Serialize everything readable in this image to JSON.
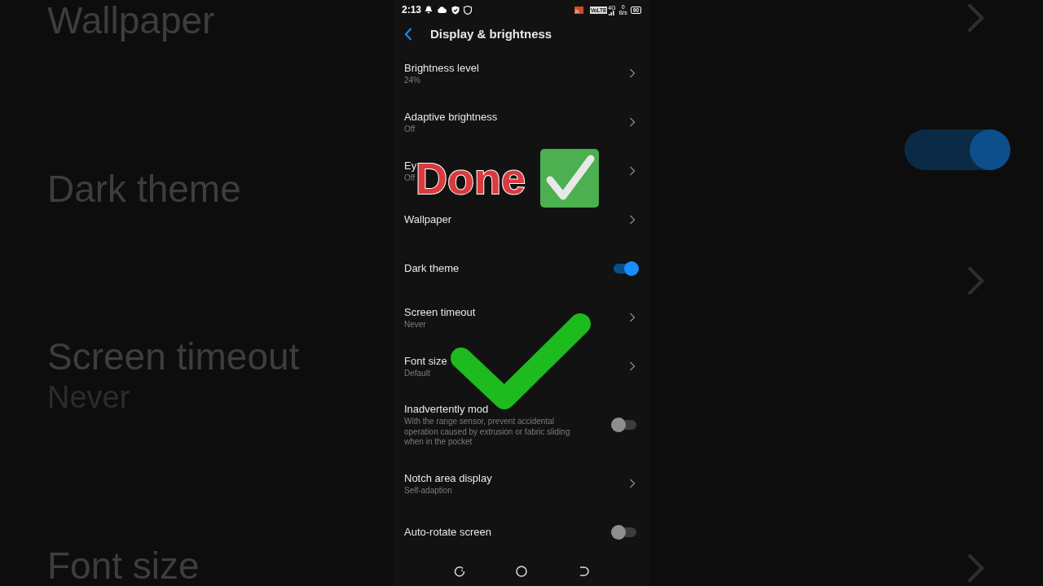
{
  "backdrop": {
    "left_labels": [
      {
        "title": "Wallpaper"
      },
      {
        "title": "Dark theme"
      },
      {
        "title": "Screen timeout",
        "subtitle": "Never"
      },
      {
        "title": "Font size"
      }
    ],
    "right_toggle_on": true
  },
  "status_bar": {
    "time": "2:13",
    "volte": "VoLTE",
    "network": "4G",
    "speed_value": "0",
    "speed_unit": "B/s",
    "battery": "90"
  },
  "header": {
    "title": "Display & brightness"
  },
  "settings": [
    {
      "kind": "link",
      "title": "Brightness level",
      "subtitle": "24%"
    },
    {
      "kind": "link",
      "title": "Adaptive brightness",
      "subtitle": "Off"
    },
    {
      "kind": "link",
      "title": "Ey",
      "subtitle": "Off"
    },
    {
      "kind": "link",
      "title": "Wallpaper"
    },
    {
      "kind": "toggle",
      "title": "Dark theme",
      "on": true
    },
    {
      "kind": "link",
      "title": "Screen timeout",
      "subtitle": "Never"
    },
    {
      "kind": "link",
      "title": "Font size",
      "subtitle": "Default"
    },
    {
      "kind": "toggle",
      "title": "Inadvertently mod",
      "subtitle": "With the range sensor, prevent accidental operation caused by extrusion or fabric sliding when in the pocket",
      "on": false
    },
    {
      "kind": "link",
      "title": "Notch area display",
      "subtitle": "Self-adaption"
    },
    {
      "kind": "toggle",
      "title": "Auto-rotate screen",
      "on": false
    }
  ],
  "overlay": {
    "text": "Done"
  }
}
